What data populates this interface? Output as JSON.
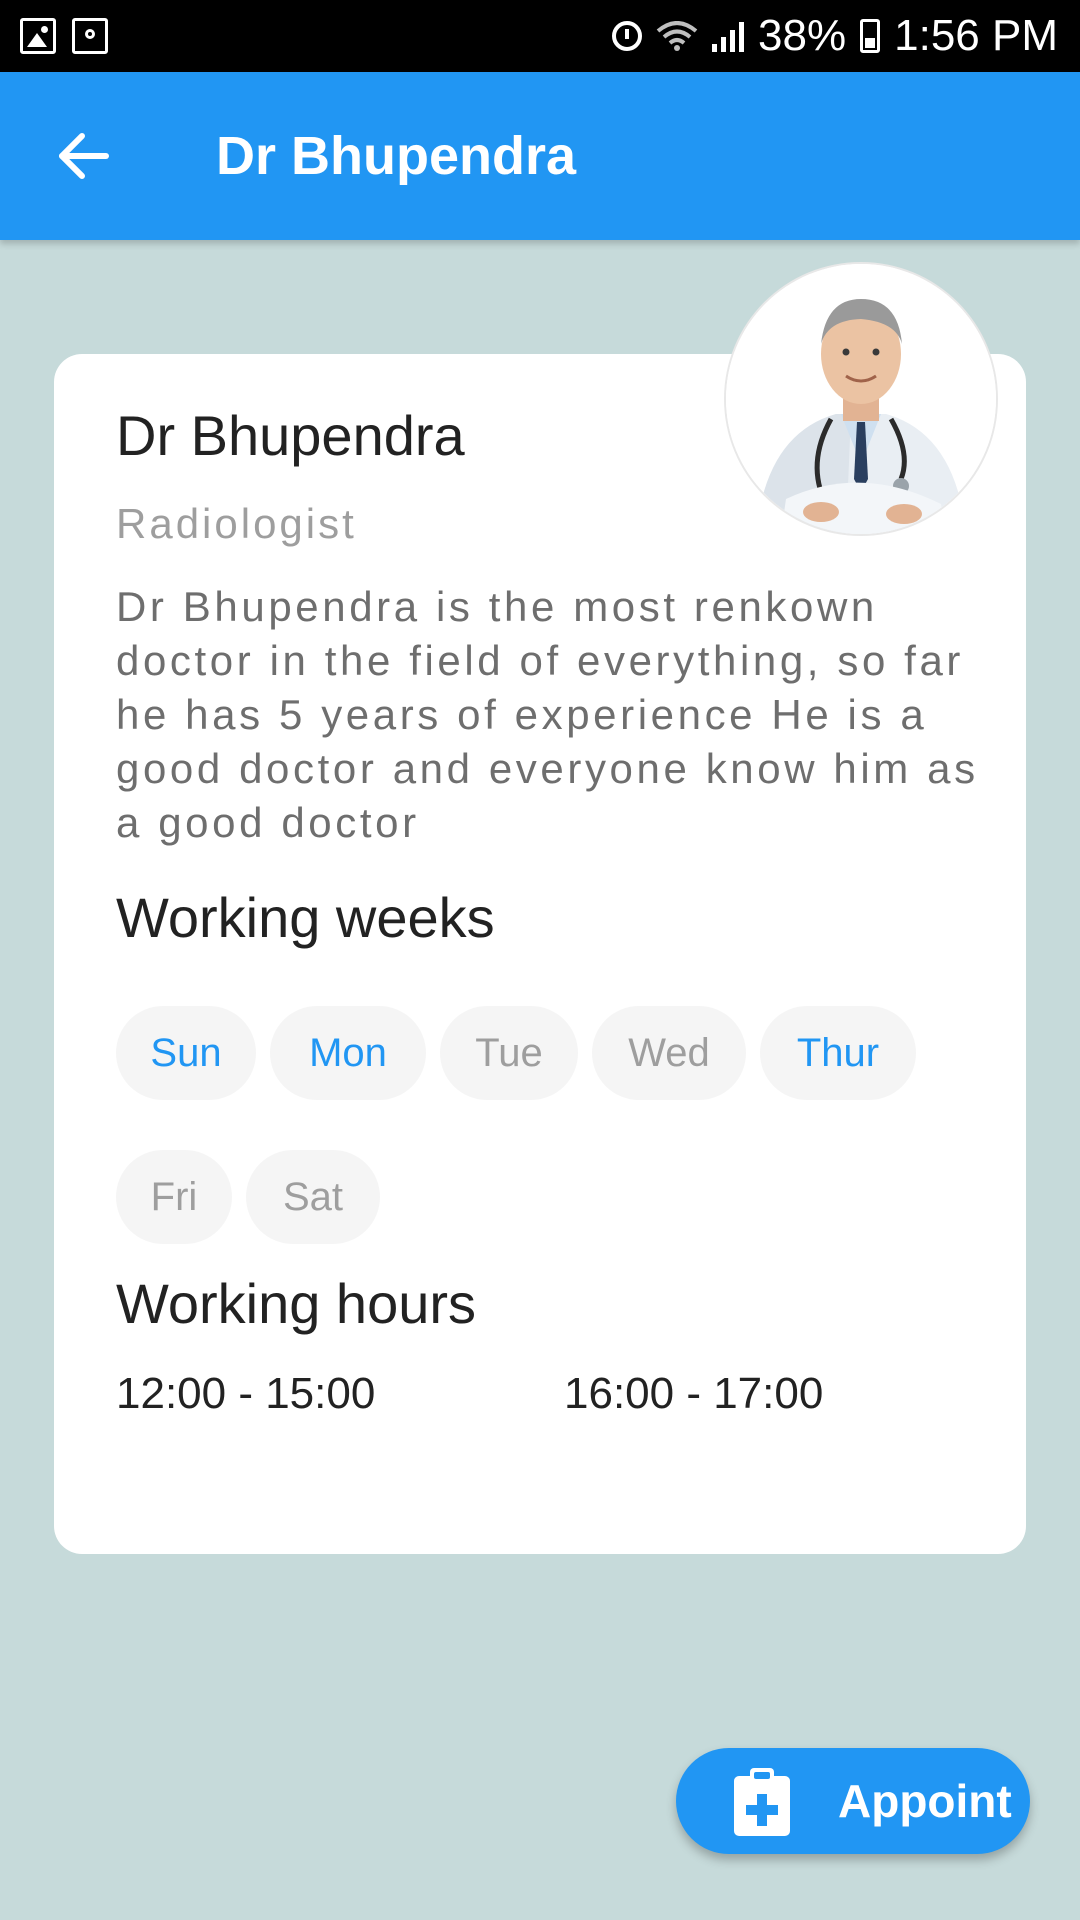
{
  "status_bar": {
    "battery_percent": "38%",
    "time": "1:56 PM",
    "left_icons": [
      "image-icon",
      "key-icon"
    ],
    "right_icons": [
      "alarm-icon",
      "wifi-icon",
      "signal-icon",
      "battery-icon"
    ]
  },
  "app_bar": {
    "back_icon": "arrow-back-icon",
    "title": "Dr Bhupendra",
    "color": "#2196F3"
  },
  "doctor": {
    "name": "Dr Bhupendra",
    "specialty": "Radiologist",
    "bio": "Dr Bhupendra is the most renkown doctor in the field of everything, so far he has 5 years of experience He is a good doctor and everyone know him as a good doctor",
    "avatar": "doctor-photo"
  },
  "working_weeks": {
    "heading": "Working weeks",
    "days": [
      {
        "label": "Sun",
        "active": true
      },
      {
        "label": "Mon",
        "active": true
      },
      {
        "label": "Tue",
        "active": false
      },
      {
        "label": "Wed",
        "active": false
      },
      {
        "label": "Thur",
        "active": true
      },
      {
        "label": "Fri",
        "active": false
      },
      {
        "label": "Sat",
        "active": false
      }
    ]
  },
  "working_hours": {
    "heading": "Working hours",
    "slots": [
      "12:00 - 15:00",
      "16:00 - 17:00"
    ]
  },
  "fab": {
    "label": "Appoint",
    "icon": "clipboard-plus-icon"
  },
  "colors": {
    "background": "#C6DADA",
    "accent": "#2196F3",
    "inactive_chip_text": "#9E9E9E",
    "chip_background": "#F5F5F5"
  }
}
